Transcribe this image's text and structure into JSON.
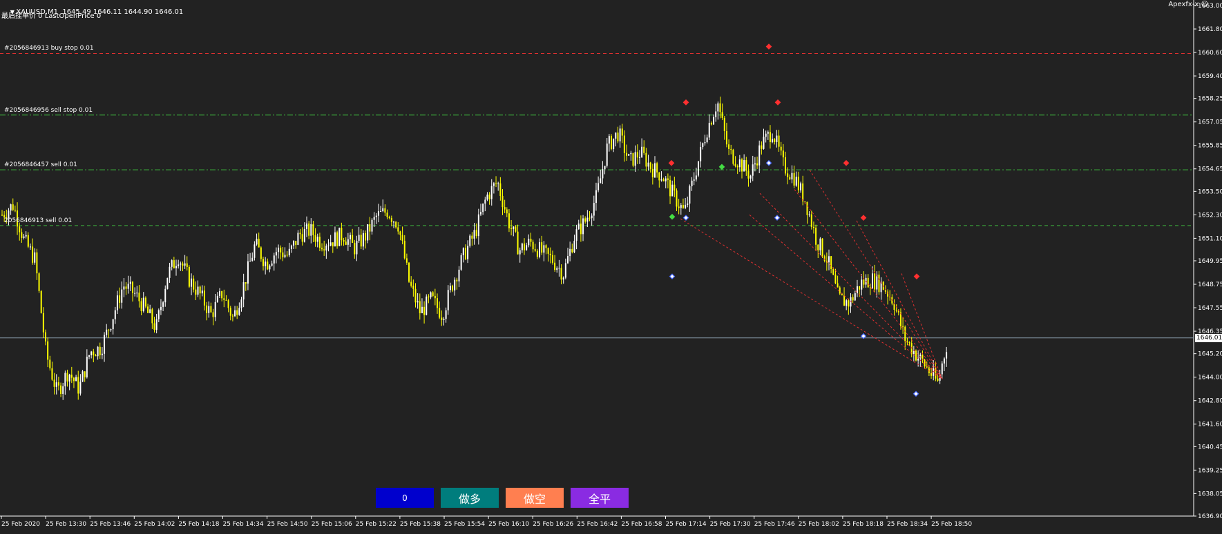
{
  "header": {
    "symbol_line": "XAUUSD,M1  1645.49 1646.11 1644.90 1646.01",
    "info_line": "最后挂单价 0 LastOpenPrice 0",
    "collapse_icon": "triangle-down-icon"
  },
  "broker": {
    "label": "Apexfx-x",
    "icon": "smiley-icon"
  },
  "order_lines": [
    {
      "label": "#2056846913 buy stop 0.01",
      "price": 1660.55,
      "color": "#e03030",
      "style": "dash"
    },
    {
      "label": "#2056846956 sell stop 0.01",
      "price": 1657.4,
      "color": "#3fbf3f",
      "style": "dashdot"
    },
    {
      "label": "#2056846457 sell 0.01",
      "price": 1654.6,
      "color": "#3fbf3f",
      "style": "dashdot"
    },
    {
      "label": "2056846913 sell 0.01",
      "price": 1651.75,
      "color": "#3fbf3f",
      "style": "dash"
    }
  ],
  "current_price": {
    "value": 1646.01,
    "label": "1646.01",
    "color": "#8899aa"
  },
  "buttons": [
    {
      "label": "0",
      "color": "#0000cd",
      "name": "count-button"
    },
    {
      "label": "做多",
      "color": "#007d7d",
      "name": "buy-button"
    },
    {
      "label": "做空",
      "color": "#ff7f50",
      "name": "sell-button"
    },
    {
      "label": "全平",
      "color": "#8a2be2",
      "name": "close-all-button"
    }
  ],
  "chart_data": {
    "type": "candlestick",
    "symbol": "XAUUSD",
    "timeframe": "M1",
    "ylim": [
      1636.9,
      1663.0
    ],
    "y_ticks": [
      "1663.00",
      "1661.80",
      "1660.60",
      "1659.40",
      "1658.25",
      "1657.05",
      "1655.85",
      "1654.65",
      "1653.50",
      "1652.30",
      "1651.10",
      "1649.95",
      "1648.75",
      "1647.55",
      "1646.35",
      "1645.20",
      "1644.00",
      "1642.80",
      "1641.60",
      "1640.45",
      "1639.25",
      "1638.05",
      "1636.90"
    ],
    "x_ticks": [
      "25 Feb 2020",
      "25 Feb 13:30",
      "25 Feb 13:46",
      "25 Feb 14:02",
      "25 Feb 14:18",
      "25 Feb 14:34",
      "25 Feb 14:50",
      "25 Feb 15:06",
      "25 Feb 15:22",
      "25 Feb 15:38",
      "25 Feb 15:54",
      "25 Feb 16:10",
      "25 Feb 16:26",
      "25 Feb 16:42",
      "25 Feb 16:58",
      "25 Feb 17:14",
      "25 Feb 17:30",
      "25 Feb 17:46",
      "25 Feb 18:02",
      "25 Feb 18:18",
      "25 Feb 18:34",
      "25 Feb 18:50"
    ],
    "up_color": "#ffffff",
    "down_color": "#ffff00",
    "price_path": [
      [
        0,
        1652.3
      ],
      [
        8,
        1652.8
      ],
      [
        16,
        1651.0
      ],
      [
        24,
        1650.0
      ],
      [
        32,
        1645.2
      ],
      [
        40,
        1643.2
      ],
      [
        48,
        1644.3
      ],
      [
        56,
        1643.4
      ],
      [
        64,
        1645.3
      ],
      [
        72,
        1645.5
      ],
      [
        80,
        1647.0
      ],
      [
        88,
        1648.7
      ],
      [
        96,
        1648.3
      ],
      [
        104,
        1647.5
      ],
      [
        112,
        1646.5
      ],
      [
        120,
        1649.2
      ],
      [
        128,
        1650.2
      ],
      [
        136,
        1649.0
      ],
      [
        144,
        1648.2
      ],
      [
        152,
        1647.2
      ],
      [
        160,
        1648.3
      ],
      [
        168,
        1647.0
      ],
      [
        176,
        1648.8
      ],
      [
        184,
        1650.8
      ],
      [
        192,
        1649.8
      ],
      [
        200,
        1650.5
      ],
      [
        208,
        1650.2
      ],
      [
        216,
        1651.3
      ],
      [
        224,
        1651.5
      ],
      [
        232,
        1650.9
      ],
      [
        240,
        1651.0
      ],
      [
        248,
        1651.3
      ],
      [
        256,
        1650.6
      ],
      [
        264,
        1651.2
      ],
      [
        272,
        1652.2
      ],
      [
        280,
        1652.5
      ],
      [
        288,
        1651.8
      ],
      [
        296,
        1648.8
      ],
      [
        304,
        1647.3
      ],
      [
        312,
        1648.0
      ],
      [
        320,
        1647.2
      ],
      [
        328,
        1648.9
      ],
      [
        336,
        1650.3
      ],
      [
        344,
        1651.4
      ],
      [
        352,
        1653.2
      ],
      [
        360,
        1654.0
      ],
      [
        368,
        1652.0
      ],
      [
        376,
        1650.5
      ],
      [
        384,
        1650.9
      ],
      [
        392,
        1650.4
      ],
      [
        400,
        1650.0
      ],
      [
        408,
        1649.3
      ],
      [
        416,
        1651.2
      ],
      [
        424,
        1652.0
      ],
      [
        432,
        1653.2
      ],
      [
        440,
        1655.8
      ],
      [
        448,
        1656.5
      ],
      [
        456,
        1655.0
      ],
      [
        464,
        1655.5
      ],
      [
        472,
        1654.7
      ],
      [
        480,
        1654.3
      ],
      [
        488,
        1653.3
      ],
      [
        496,
        1652.4
      ],
      [
        504,
        1654.5
      ],
      [
        512,
        1656.6
      ],
      [
        520,
        1658.1
      ],
      [
        528,
        1655.5
      ],
      [
        536,
        1655.0
      ],
      [
        544,
        1654.3
      ],
      [
        552,
        1655.9
      ],
      [
        560,
        1656.6
      ],
      [
        568,
        1654.8
      ],
      [
        576,
        1654.2
      ],
      [
        584,
        1653.0
      ],
      [
        592,
        1651.0
      ],
      [
        600,
        1650.0
      ],
      [
        608,
        1648.0
      ],
      [
        616,
        1647.8
      ],
      [
        624,
        1648.8
      ],
      [
        632,
        1649.0
      ],
      [
        640,
        1648.7
      ],
      [
        648,
        1647.9
      ],
      [
        656,
        1646.0
      ],
      [
        664,
        1645.2
      ],
      [
        672,
        1644.5
      ],
      [
        680,
        1643.7
      ],
      [
        688,
        1646.1
      ]
    ],
    "signals": [
      {
        "x": 972,
        "price": 1654.95,
        "color": "#ff3030",
        "type": "sell"
      },
      {
        "x": 993,
        "price": 1658.05,
        "color": "#ff3030",
        "type": "sell"
      },
      {
        "x": 1113,
        "price": 1660.9,
        "color": "#ff3030",
        "type": "sell"
      },
      {
        "x": 1126,
        "price": 1658.05,
        "color": "#ff3030",
        "type": "sell"
      },
      {
        "x": 1225,
        "price": 1654.95,
        "color": "#ff3030",
        "type": "sell"
      },
      {
        "x": 1250,
        "price": 1652.15,
        "color": "#ff3030",
        "type": "sell"
      },
      {
        "x": 1327,
        "price": 1649.15,
        "color": "#ff3030",
        "type": "sell"
      },
      {
        "x": 973,
        "price": 1649.15,
        "color": "#4466ff",
        "type": "buy"
      },
      {
        "x": 993,
        "price": 1652.15,
        "color": "#4466ff",
        "type": "buy"
      },
      {
        "x": 1113,
        "price": 1654.95,
        "color": "#4466ff",
        "type": "buy"
      },
      {
        "x": 1125,
        "price": 1652.15,
        "color": "#4466ff",
        "type": "buy"
      },
      {
        "x": 1250,
        "price": 1646.1,
        "color": "#4466ff",
        "type": "buy"
      },
      {
        "x": 1326,
        "price": 1643.15,
        "color": "#4466ff",
        "type": "buy"
      },
      {
        "x": 973,
        "price": 1652.2,
        "color": "#44dd44",
        "type": "flat"
      },
      {
        "x": 1045,
        "price": 1654.75,
        "color": "#44dd44",
        "type": "flat"
      }
    ],
    "trade_lines": [
      {
        "x1": 985,
        "p1": 1652.1,
        "x2": 1364,
        "p2": 1643.9
      },
      {
        "x1": 1085,
        "p1": 1652.3,
        "x2": 1364,
        "p2": 1643.9
      },
      {
        "x1": 1100,
        "p1": 1653.4,
        "x2": 1364,
        "p2": 1643.9
      },
      {
        "x1": 1150,
        "p1": 1653.6,
        "x2": 1364,
        "p2": 1643.9
      },
      {
        "x1": 1172,
        "p1": 1654.6,
        "x2": 1364,
        "p2": 1643.9
      },
      {
        "x1": 1240,
        "p1": 1652.0,
        "x2": 1364,
        "p2": 1643.9
      },
      {
        "x1": 1305,
        "p1": 1649.3,
        "x2": 1364,
        "p2": 1643.9
      }
    ]
  }
}
